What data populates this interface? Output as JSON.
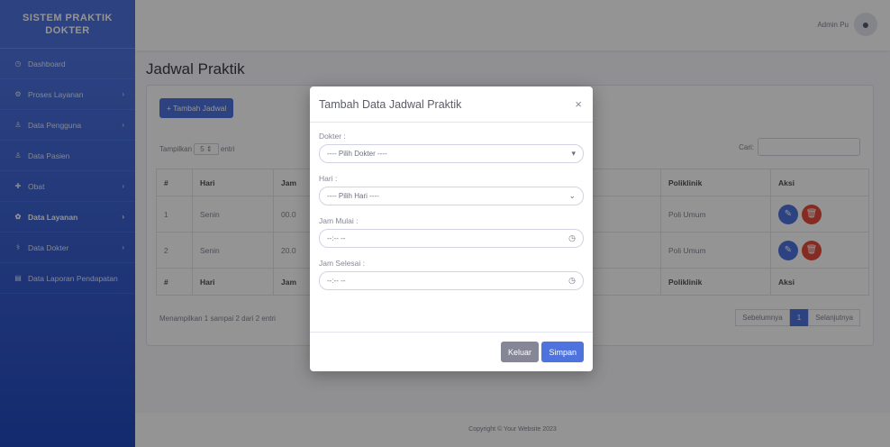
{
  "sidebar": {
    "brand": "SISTEM PRAKTIK DOKTER",
    "items": [
      {
        "label": "Dashboard",
        "icon": "dashboard-icon",
        "has_chevron": false
      },
      {
        "label": "Proses Layanan",
        "icon": "process-icon",
        "has_chevron": true
      },
      {
        "label": "Data Pengguna",
        "icon": "user-icon",
        "has_chevron": true
      },
      {
        "label": "Data Pasien",
        "icon": "patient-icon",
        "has_chevron": false
      },
      {
        "label": "Obat",
        "icon": "pill-icon",
        "has_chevron": true
      },
      {
        "label": "Data Layanan",
        "icon": "gear-icon",
        "has_chevron": true
      },
      {
        "label": "Data Dokter",
        "icon": "doctor-icon",
        "has_chevron": true
      },
      {
        "label": "Data Laporan Pendapatan",
        "icon": "report-icon",
        "has_chevron": false
      }
    ]
  },
  "topbar": {
    "user_name": "Admin Pu"
  },
  "page": {
    "title": "Jadwal Praktik"
  },
  "card": {
    "add_button": "Tambah Jadwal",
    "length_label_prefix": "Tampilkan",
    "length_value": "5",
    "length_label_suffix": "entri",
    "search_label": "Cari:",
    "columns": [
      "#",
      "Hari",
      "Jam",
      "Poliklinik",
      "Aksi"
    ],
    "rows": [
      {
        "no": "1",
        "hari": "Senin",
        "jam": "00.0",
        "poli": "Poli Umum"
      },
      {
        "no": "2",
        "hari": "Senin",
        "jam": "20.0",
        "poli": "Poli Umum"
      }
    ],
    "info": "Menampilkan 1 sampai 2 dari 2 entri",
    "pager": {
      "prev": "Sebelumnya",
      "current": "1",
      "next": "Selanjutnya"
    }
  },
  "footer": "Copyright © Your Website 2023",
  "modal": {
    "title": "Tambah Data Jadwal Praktik",
    "close": "×",
    "dokter_label": "Dokter :",
    "dokter_placeholder": "---- Pilih Dokter ----",
    "hari_label": "Hari :",
    "hari_placeholder": "---- Pilih Hari ----",
    "jam_mulai_label": "Jam Mulai :",
    "jam_mulai_value": "--:-- --",
    "jam_selesai_label": "Jam Selesai :",
    "jam_selesai_value": "--:-- --",
    "cancel_button": "Keluar",
    "save_button": "Simpan"
  },
  "colors": {
    "primary": "#4e73df",
    "danger": "#e74a3b",
    "secondary": "#858796"
  }
}
